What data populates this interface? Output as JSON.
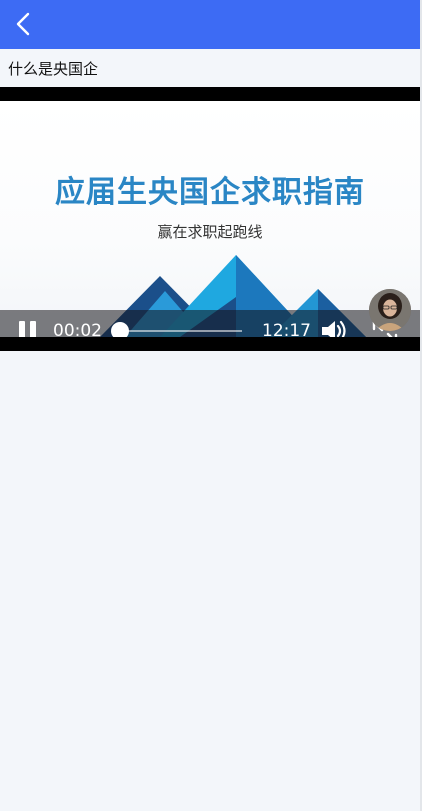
{
  "header": {
    "back_icon": "chevron-left-icon",
    "background_color": "#3d6bf4"
  },
  "page": {
    "title": "什么是央国企"
  },
  "video": {
    "slide": {
      "title": "应届生央国企求职指南",
      "subtitle": "赢在求职起跑线"
    },
    "player": {
      "current_time": "00:02",
      "total_time": "12:17",
      "progress_fraction": 0.0,
      "state": "playing",
      "pause_icon": "pause-icon",
      "volume_icon": "volume-icon",
      "fullscreen_icon": "fullscreen-icon"
    },
    "presenter_avatar": "presenter-avatar"
  },
  "colors": {
    "accent": "#3d6bf4",
    "slide_title": "#2a86c5",
    "page_background": "#f3f6fa"
  }
}
